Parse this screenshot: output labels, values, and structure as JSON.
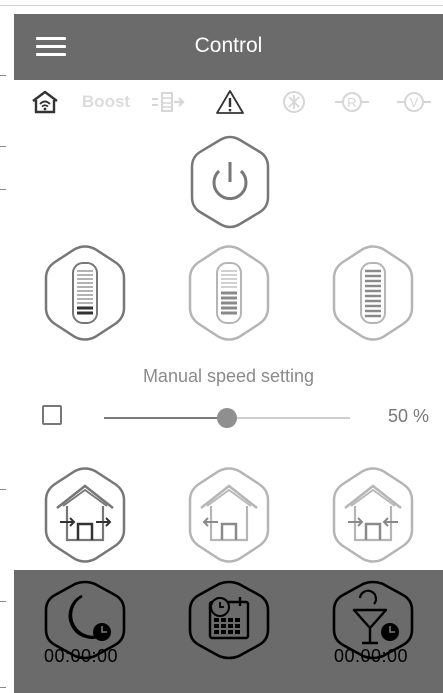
{
  "header": {
    "title": "Control"
  },
  "status": {
    "boost_label": "Boost"
  },
  "manual": {
    "label": "Manual speed setting",
    "value": 50,
    "value_text": "50 %"
  },
  "speeds": [
    {
      "name": "speed-low",
      "level": "low"
    },
    {
      "name": "speed-medium",
      "level": "medium"
    },
    {
      "name": "speed-high",
      "level": "high"
    }
  ],
  "footer": {
    "night_timer": "00:00:00",
    "party_timer": "00:00:00"
  },
  "colors": {
    "header_bg": "#6b6b6b",
    "icon_stroke": "#777777",
    "icon_disabled": "#d4d4d4"
  }
}
